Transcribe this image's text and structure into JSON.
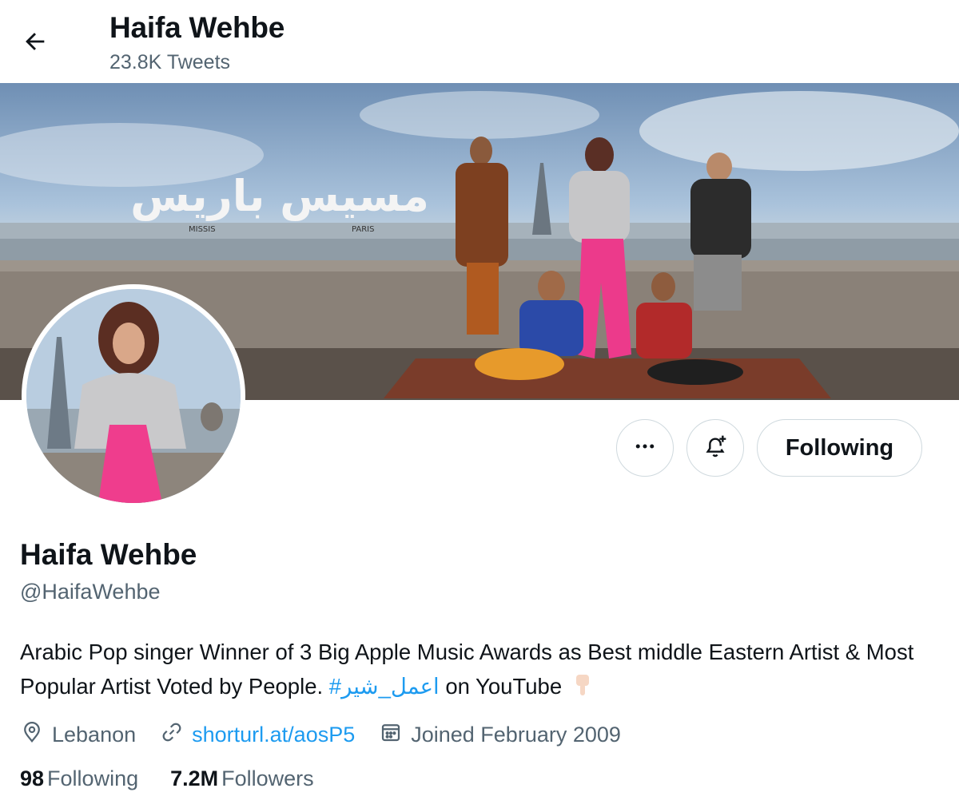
{
  "header": {
    "back_icon": "arrow-left-icon",
    "name": "Haifa Wehbe",
    "tweet_count": "23.8K Tweets"
  },
  "banner": {
    "title_text": "مسيس باريس",
    "sub_left": "MISSIS",
    "sub_right": "PARIS"
  },
  "actions": {
    "more_icon": "more-horizontal-icon",
    "notify_icon": "bell-plus-icon",
    "following_label": "Following"
  },
  "profile": {
    "display_name": "Haifa Wehbe",
    "handle": "@HaifaWehbe",
    "bio_text": "Arabic Pop singer Winner of 3 Big Apple Music Awards as Best middle Eastern Artist & Most Popular Artist Voted by People.",
    "bio_hashtag": "#اعمل_شير",
    "bio_suffix": "on YouTube",
    "bio_emoji_icon": "pointing-down-hand-icon",
    "location": "Lebanon",
    "url": "shorturl.at/aosP5",
    "joined": "Joined February 2009"
  },
  "stats": {
    "following_count": "98",
    "following_label": "Following",
    "followers_count": "7.2M",
    "followers_label": "Followers"
  },
  "colors": {
    "accent": "#1d9bf0",
    "secondary_text": "#536471",
    "border": "#cfd9de"
  }
}
